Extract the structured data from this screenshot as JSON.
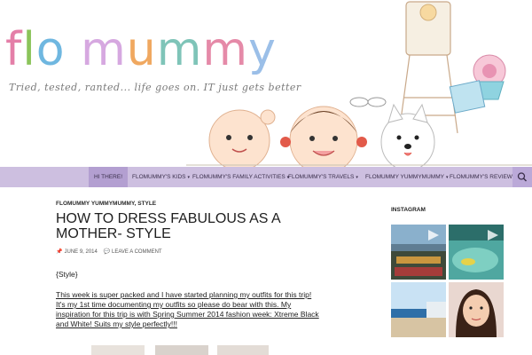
{
  "header": {
    "logo_letters": [
      "f",
      "l",
      "o",
      " ",
      "m",
      "u",
      "m",
      "m",
      "y"
    ],
    "logo_colors": [
      "#e47fa8",
      "#8bc45a",
      "#6fb7e0",
      "",
      "#d6a8e0",
      "#f0a860",
      "#7fc4b8",
      "#e58aa8",
      "#9bbfe8"
    ],
    "tagline": "Tried, tested, ranted... life goes on. IT just gets better"
  },
  "nav": {
    "items": [
      {
        "label": "HI THERE!",
        "has_caret": false
      },
      {
        "label": "FLOMUMMY'S KIDS",
        "has_caret": true
      },
      {
        "label": "FLOMUMMY'S FAMILY ACTIVITIES",
        "has_caret": true
      },
      {
        "label": "FLOMUMMY'S TRAVELS",
        "has_caret": true
      },
      {
        "label": "FLOMUMMY YUMMYMUMMY",
        "has_caret": true
      },
      {
        "label": "FLOMUMMY'S REVIEWS",
        "has_caret": false
      }
    ],
    "caret": "▾"
  },
  "post": {
    "categories": "FLOMUMMY YUMMYMUMMY, STYLE",
    "title": "HOW TO DRESS FABULOUS AS A MOTHER- STYLE",
    "date": "JUNE 9, 2014",
    "comments": "LEAVE A COMMENT",
    "style_tag": "{Style}",
    "paragraph": "This week is super packed and I have started planning my outfits for this trip! It's my 1st time documenting my outfits so please do bear with this. My inspiration for this trip is  with  Spring Summer 2014 fashion week: Xtreme Black and White! Suits my style perfectly!!!"
  },
  "sidebar": {
    "widget_title": "INSTAGRAM"
  },
  "colors": {
    "nav_bg": "#cdbfe0",
    "nav_active": "#b39fd1"
  }
}
